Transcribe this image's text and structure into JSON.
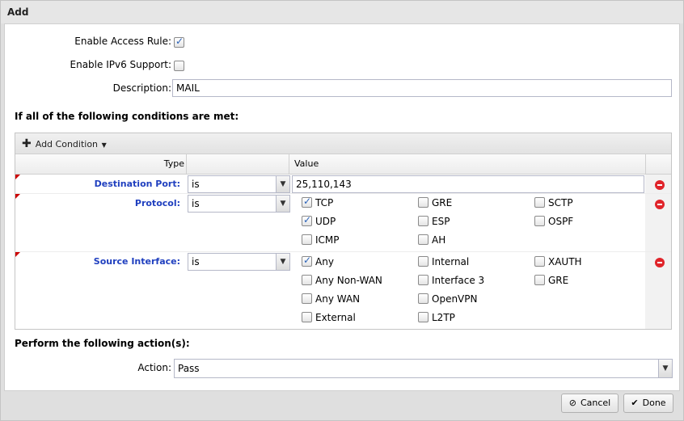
{
  "dialog": {
    "title": "Add"
  },
  "form": {
    "enable_access_rule_label": "Enable Access Rule:",
    "enable_access_rule_checked": true,
    "enable_ipv6_label": "Enable IPv6 Support:",
    "enable_ipv6_checked": false,
    "description_label": "Description:",
    "description_value": "MAIL"
  },
  "conditions": {
    "heading": "If all of the following conditions are met:",
    "add_condition_label": "Add Condition",
    "columns": {
      "type": "Type",
      "blank": "",
      "value": "Value"
    },
    "destination_port": {
      "label": "Destination Port:",
      "operator": "is",
      "value": "25,110,143"
    },
    "protocol": {
      "label": "Protocol:",
      "operator": "is",
      "options": [
        {
          "label": "TCP",
          "checked": true
        },
        {
          "label": "GRE",
          "checked": false
        },
        {
          "label": "SCTP",
          "checked": false
        },
        {
          "label": "UDP",
          "checked": true
        },
        {
          "label": "ESP",
          "checked": false
        },
        {
          "label": "OSPF",
          "checked": false
        },
        {
          "label": "ICMP",
          "checked": false
        },
        {
          "label": "AH",
          "checked": false
        }
      ]
    },
    "source_interface": {
      "label": "Source Interface:",
      "operator": "is",
      "options": [
        {
          "label": "Any",
          "checked": true
        },
        {
          "label": "Internal",
          "checked": false
        },
        {
          "label": "XAUTH",
          "checked": false
        },
        {
          "label": "Any Non-WAN",
          "checked": false
        },
        {
          "label": "Interface 3",
          "checked": false
        },
        {
          "label": "GRE",
          "checked": false
        },
        {
          "label": "Any WAN",
          "checked": false
        },
        {
          "label": "OpenVPN",
          "checked": false
        },
        {
          "label": "External",
          "checked": false
        },
        {
          "label": "L2TP",
          "checked": false
        }
      ]
    }
  },
  "actions": {
    "heading": "Perform the following action(s):",
    "action_label": "Action:",
    "action_value": "Pass"
  },
  "buttons": {
    "cancel": "Cancel",
    "done": "Done"
  },
  "colors": {
    "label_blue": "#1f3fbf",
    "remove_red": "#e0242a",
    "check_blue": "#2a62b8"
  }
}
